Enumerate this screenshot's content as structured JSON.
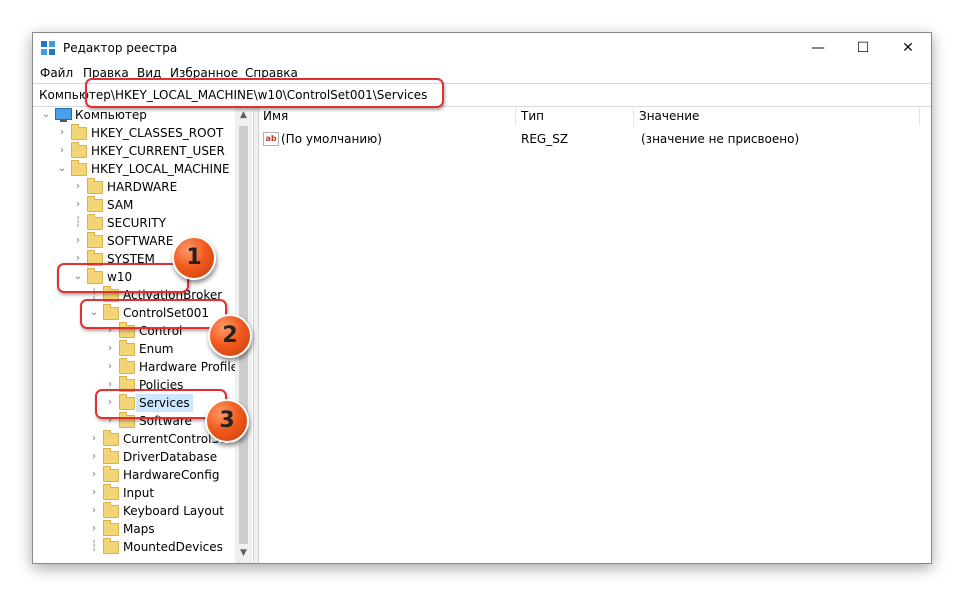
{
  "window": {
    "title": "Редактор реестра",
    "controls": {
      "minimize": "—",
      "maximize": "☐",
      "close": "✕"
    }
  },
  "menu": [
    "Файл",
    "Правка",
    "Вид",
    "Избранное",
    "Справка"
  ],
  "address": {
    "path": "Компьютер\\HKEY_LOCAL_MACHINE\\w10\\ControlSet001\\Services"
  },
  "tree": {
    "root": "Компьютер",
    "items": [
      {
        "label": "HKEY_CLASSES_ROOT"
      },
      {
        "label": "HKEY_CURRENT_USER"
      },
      {
        "label": "HKEY_LOCAL_MACHINE"
      },
      {
        "label": "HARDWARE"
      },
      {
        "label": "SAM"
      },
      {
        "label": "SECURITY"
      },
      {
        "label": "SOFTWARE"
      },
      {
        "label": "SYSTEM"
      },
      {
        "label": "w10"
      },
      {
        "label": "ActivationBroker"
      },
      {
        "label": "ControlSet001"
      },
      {
        "label": "Control"
      },
      {
        "label": "Enum"
      },
      {
        "label": "Hardware Profiles"
      },
      {
        "label": "Policies"
      },
      {
        "label": "Services"
      },
      {
        "label": "Software"
      },
      {
        "label": "CurrentControlSet"
      },
      {
        "label": "DriverDatabase"
      },
      {
        "label": "HardwareConfig"
      },
      {
        "label": "Input"
      },
      {
        "label": "Keyboard Layout"
      },
      {
        "label": "Maps"
      },
      {
        "label": "MountedDevices"
      }
    ]
  },
  "list": {
    "columns": [
      "Имя",
      "Тип",
      "Значение"
    ],
    "rows": [
      {
        "name": "(По умолчанию)",
        "type": "REG_SZ",
        "value": "(значение не присвоено)"
      }
    ]
  },
  "annotations": {
    "badges": [
      "1",
      "2",
      "3"
    ]
  },
  "colors": {
    "callout": "#e03030",
    "badge": "#f25a1e",
    "selection": "#cce8ff",
    "folder": "#f3d477"
  }
}
